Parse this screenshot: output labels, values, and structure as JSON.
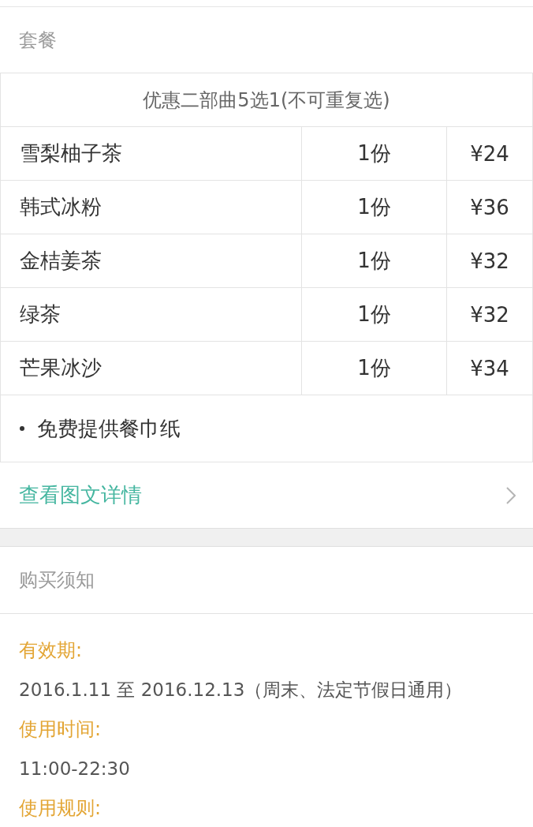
{
  "package": {
    "title": "套餐",
    "table": {
      "header": "优惠二部曲5选1(不可重复选)",
      "rows": [
        {
          "name": "雪梨柚子茶",
          "quantity": "1份",
          "price": "¥24"
        },
        {
          "name": "韩式冰粉",
          "quantity": "1份",
          "price": "¥36"
        },
        {
          "name": "金桔姜茶",
          "quantity": "1份",
          "price": "¥32"
        },
        {
          "name": "绿茶",
          "quantity": "1份",
          "price": "¥32"
        },
        {
          "name": "芒果冰沙",
          "quantity": "1份",
          "price": "¥34"
        }
      ]
    },
    "notes": [
      "免费提供餐巾纸"
    ],
    "details_link": "查看图文详情"
  },
  "purchase_notice": {
    "title": "购买须知",
    "items": [
      {
        "label": "有效期:",
        "value": "2016.1.11 至 2016.12.13（周末、法定节假日通用）"
      },
      {
        "label": "使用时间:",
        "value": "11:00-22:30"
      },
      {
        "label": "使用规则:"
      }
    ]
  }
}
